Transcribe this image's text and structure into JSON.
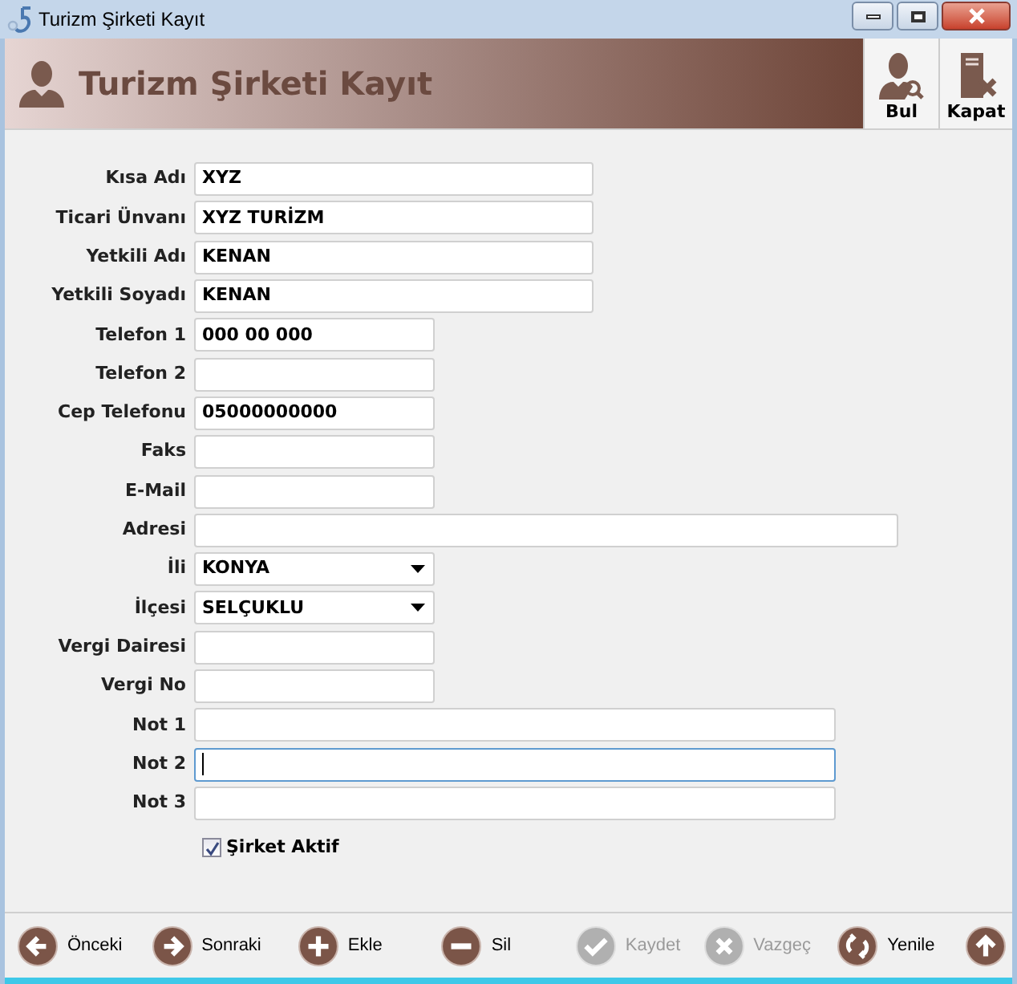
{
  "window": {
    "title": "Turizm Şirketi Kayıt"
  },
  "header": {
    "title": "Turizm Şirketi Kayıt",
    "tools": [
      {
        "label": "Bul"
      },
      {
        "label": "Kapat"
      }
    ]
  },
  "form": {
    "fields": [
      {
        "label": "Kısa Adı",
        "kind": "text",
        "value": "XYZ",
        "focused": false
      },
      {
        "label": "Ticari Ünvanı",
        "kind": "text",
        "value": "XYZ TURİZM",
        "focused": false
      },
      {
        "label": "Yetkili Adı",
        "kind": "text",
        "value": "KENAN",
        "focused": false
      },
      {
        "label": "Yetkili Soyadı",
        "kind": "text",
        "value": "KENAN",
        "focused": false
      },
      {
        "label": "Telefon 1",
        "kind": "text",
        "value": "000 00 000",
        "focused": false
      },
      {
        "label": "Telefon 2",
        "kind": "text",
        "focused": false
      },
      {
        "label": "Cep Telefonu",
        "kind": "text",
        "value": "05000000000",
        "focused": false
      },
      {
        "label": "Faks",
        "kind": "text",
        "focused": false
      },
      {
        "label": "E-Mail",
        "kind": "text",
        "focused": false
      },
      {
        "label": "Adresi",
        "kind": "text",
        "focused": false
      },
      {
        "label": "İli",
        "kind": "select",
        "value": "KONYA",
        "focused": false
      },
      {
        "label": "İlçesi",
        "kind": "select",
        "value": "SELÇUKLU",
        "focused": false
      },
      {
        "label": "Vergi Dairesi",
        "kind": "text",
        "focused": false
      },
      {
        "label": "Vergi No",
        "kind": "text",
        "focused": false
      },
      {
        "label": "Not 1",
        "kind": "text",
        "focused": false
      },
      {
        "label": "Not 2",
        "kind": "text",
        "focused": true
      },
      {
        "label": "Not 3",
        "kind": "text",
        "focused": false
      }
    ],
    "active": {
      "label": "Şirket Aktif",
      "checked": true
    }
  },
  "toolbar": [
    {
      "label": "Önceki",
      "disabled": false
    },
    {
      "label": "Sonraki",
      "disabled": false
    },
    {
      "label": "Ekle",
      "disabled": false
    },
    {
      "label": "Sil",
      "disabled": false
    },
    {
      "label": "Kaydet",
      "disabled": true
    },
    {
      "label": "Vazgeç",
      "disabled": true
    },
    {
      "label": "Yenile",
      "disabled": false
    },
    {
      "disabled": false
    }
  ]
}
